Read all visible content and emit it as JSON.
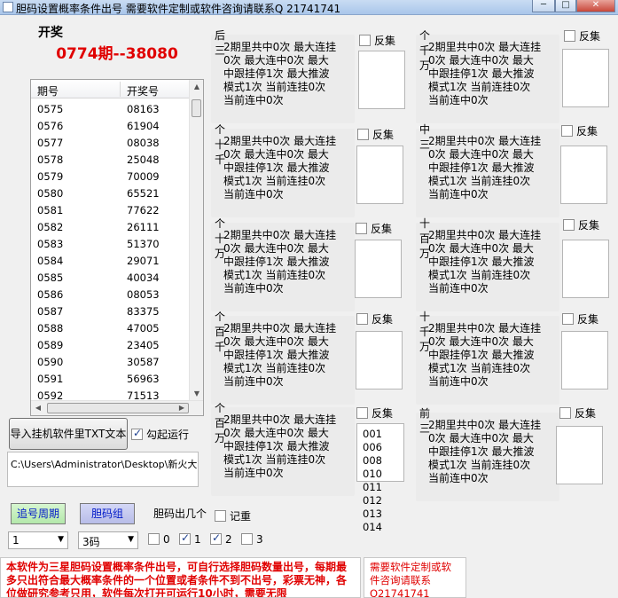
{
  "window": {
    "title": "胆码设置概率条件出号 需要软件定制或软件咨询请联系Q 21741741",
    "minimize": "─",
    "maximize": "□",
    "close": "✕"
  },
  "lottery": {
    "label": "开奖",
    "current": "0774期--38080"
  },
  "history": {
    "columns": [
      "期号",
      "开奖号"
    ],
    "rows": [
      [
        "0575",
        "08163"
      ],
      [
        "0576",
        "61904"
      ],
      [
        "0577",
        "08038"
      ],
      [
        "0578",
        "25048"
      ],
      [
        "0579",
        "70009"
      ],
      [
        "0580",
        "65521"
      ],
      [
        "0581",
        "77622"
      ],
      [
        "0582",
        "26111"
      ],
      [
        "0583",
        "51370"
      ],
      [
        "0584",
        "29071"
      ],
      [
        "0585",
        "40034"
      ],
      [
        "0586",
        "08053"
      ],
      [
        "0587",
        "83375"
      ],
      [
        "0588",
        "47005"
      ],
      [
        "0589",
        "23405"
      ],
      [
        "0590",
        "30587"
      ],
      [
        "0591",
        "56963"
      ],
      [
        "0592",
        "71513"
      ]
    ]
  },
  "controls": {
    "import_button": "导入挂机软件里TXT文本",
    "auto_run": "勾起运行",
    "path": "C:\\Users\\Administrator\\Desktop\\新火大"
  },
  "stats_text": "2期里共中0次 最大连挂0次 最大连中0次 最大中跟挂停1次 最大推波模式1次 当前连挂0次 当前连中0次",
  "invert_label": "反集",
  "groups": [
    {
      "label": "后三"
    },
    {
      "label": "个千万"
    },
    {
      "label": "个十千"
    },
    {
      "label": "中三"
    },
    {
      "label": "个十万"
    },
    {
      "label": "十百万"
    },
    {
      "label": "个百千"
    },
    {
      "label": "十千万"
    },
    {
      "label": "个百万"
    },
    {
      "label": "前三"
    }
  ],
  "number_list": [
    "001 006",
    "008 010",
    "011 012",
    "013 014"
  ],
  "bottom": {
    "follow_button": "追号周期",
    "dan_button": "胆码组",
    "dan_count_label": "胆码出几个",
    "record": "记重",
    "period_value": "1",
    "code_value": "3码",
    "digits": [
      "0",
      "1",
      "2",
      "3"
    ]
  },
  "notes": {
    "warning": "本软件为三星胆码设置概率条件出号，可自行选择胆码数量出号，每期最多只出符合最大概率条件的一个位置或者条件不到不出号，彩票无神，各位做研究参考只用，软件每次打开可运行10小时，需要无限",
    "contact": "需要软件定制或软件咨询请联系Q21741741"
  }
}
